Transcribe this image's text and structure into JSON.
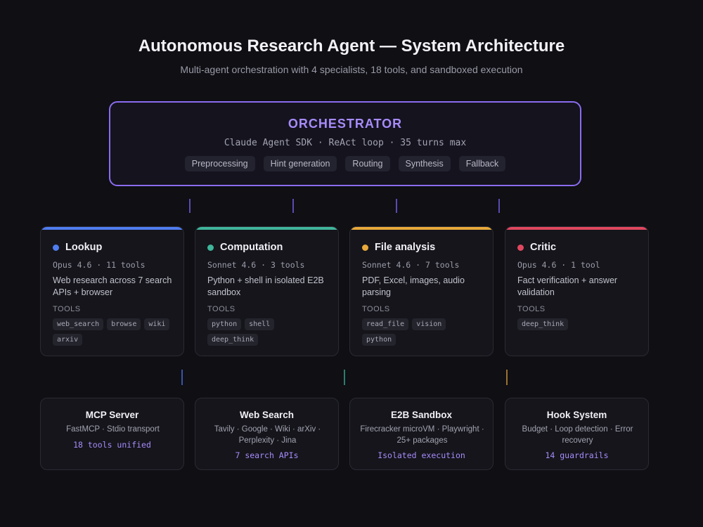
{
  "header": {
    "title": "Autonomous Research Agent — System Architecture",
    "subtitle": "Multi-agent orchestration with 4 specialists, 18 tools, and sandboxed execution"
  },
  "orchestrator": {
    "title": "ORCHESTRATOR",
    "subtitle": "Claude Agent SDK · ReAct loop · 35 turns max",
    "steps": [
      "Preprocessing",
      "Hint generation",
      "Routing",
      "Synthesis",
      "Fallback"
    ]
  },
  "agents": [
    {
      "name": "Lookup",
      "color": "#4f7cf0",
      "model": "Opus 4.6 · 11 tools",
      "description": "Web research across 7 search APIs + browser",
      "tools_label": "TOOLS",
      "tools": [
        "web_search",
        "browse",
        "wiki",
        "arxiv"
      ]
    },
    {
      "name": "Computation",
      "color": "#3fb59b",
      "model": "Sonnet 4.6 · 3 tools",
      "description": "Python + shell in isolated E2B sandbox",
      "tools_label": "TOOLS",
      "tools": [
        "python",
        "shell",
        "deep_think"
      ]
    },
    {
      "name": "File analysis",
      "color": "#e8a93a",
      "model": "Sonnet 4.6 · 7 tools",
      "description": "PDF, Excel, images, audio parsing",
      "tools_label": "TOOLS",
      "tools": [
        "read_file",
        "vision",
        "python"
      ]
    },
    {
      "name": "Critic",
      "color": "#e0475f",
      "model": "Opus 4.6 · 1 tool",
      "description": "Fact verification + answer validation",
      "tools_label": "TOOLS",
      "tools": [
        "deep_think"
      ]
    }
  ],
  "infrastructure": [
    {
      "name": "MCP Server",
      "description": "FastMCP · Stdio transport",
      "stat": "18 tools unified"
    },
    {
      "name": "Web Search",
      "description": "Tavily · Google · Wiki · arXiv · Perplexity · Jina",
      "stat": "7 search APIs"
    },
    {
      "name": "E2B Sandbox",
      "description": "Firecracker microVM · Playwright · 25+ packages",
      "stat": "Isolated execution"
    },
    {
      "name": "Hook System",
      "description": "Budget · Loop detection · Error recovery",
      "stat": "14 guardrails"
    }
  ],
  "colors": {
    "accent": "#8b6cf0",
    "accent_text": "#a78bfa",
    "background": "#0f0f14",
    "card": "#15151b"
  }
}
